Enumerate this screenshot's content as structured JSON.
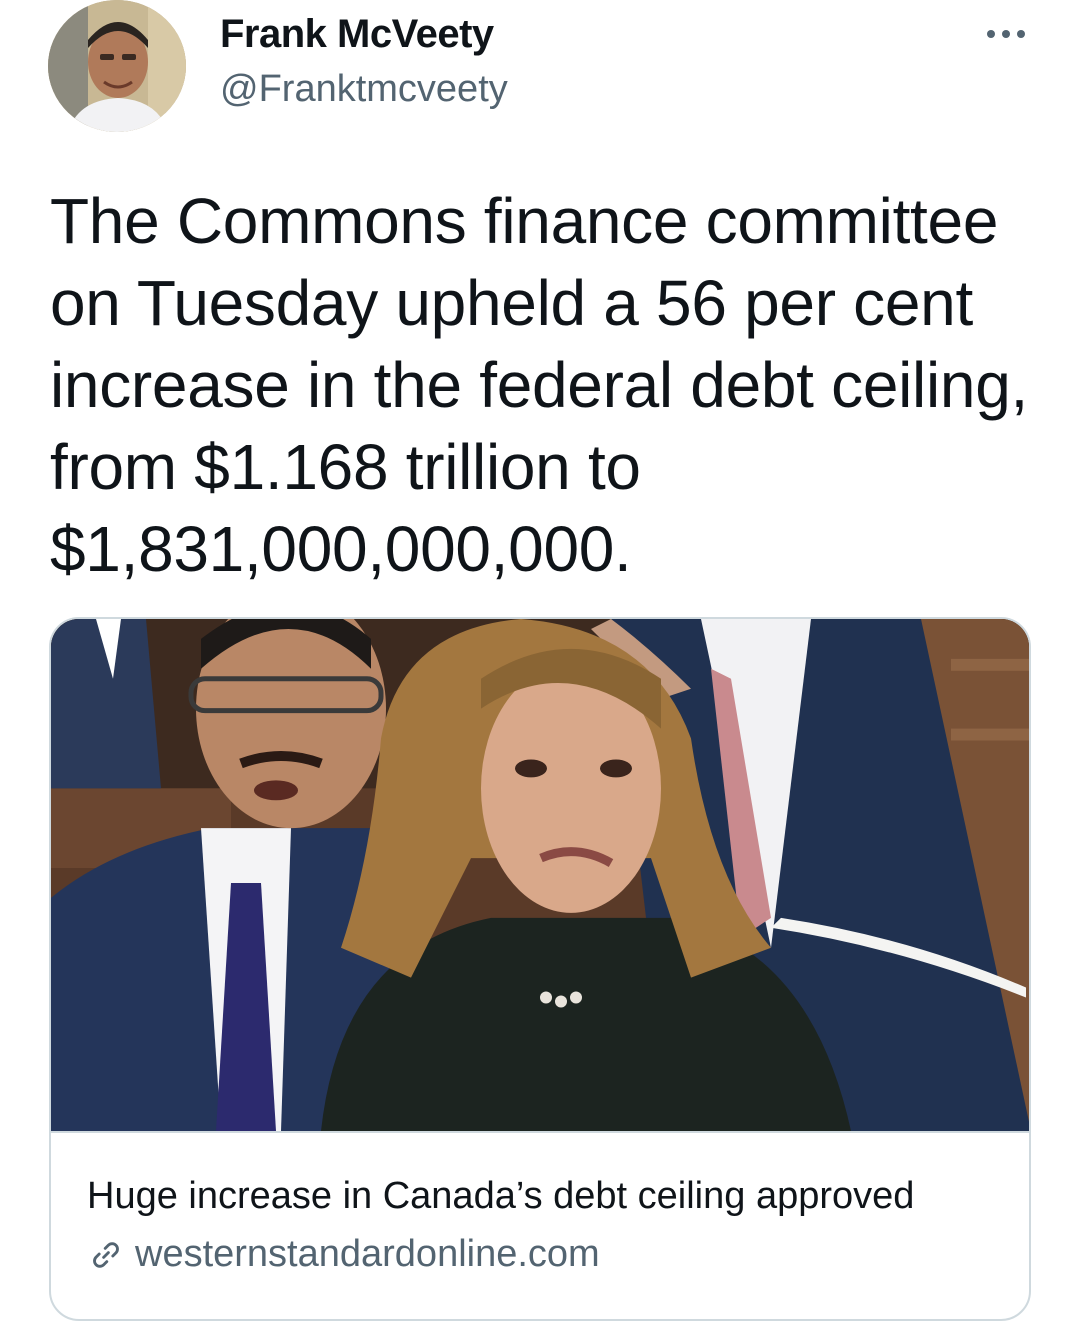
{
  "tweet": {
    "author_name": "Frank McVeety",
    "author_handle": "@Franktmcveety",
    "text": "The Commons finance committee on Tuesday upheld a 56 per cent increase in the federal debt ceiling, from $1.168 trillion to $1,831,000,000,000.",
    "more_icon": "more-horizontal-icon"
  },
  "card": {
    "title": "Huge increase in Canada’s debt ceiling approved",
    "domain": "westernstandardonline.com",
    "domain_icon": "link-icon"
  },
  "colors": {
    "text_primary": "#0f1419",
    "text_secondary": "#536471",
    "card_border": "#cfd9de"
  }
}
